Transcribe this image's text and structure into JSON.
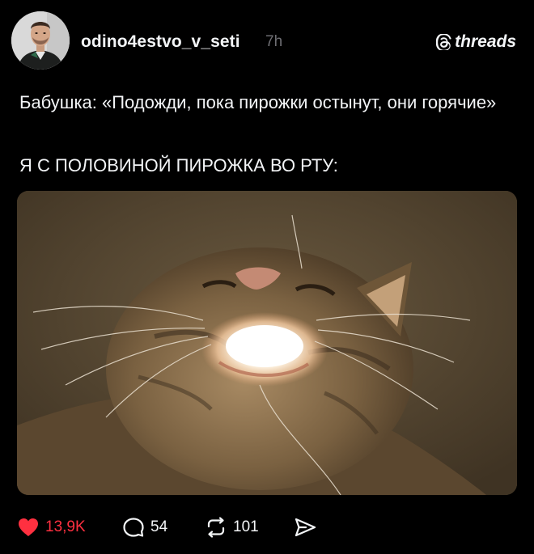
{
  "post": {
    "username": "odino4estvo_v_seti",
    "time": "7h",
    "brand": "threads",
    "text_line1": "Бабушка: «Подожди, пока пирожки остынут, они горячие»",
    "text_line2": "Я С ПОЛОВИНОЙ ПИРОЖКА ВО РТУ:",
    "image_icon": "cat-photo"
  },
  "actions": {
    "likes": "13,9K",
    "comments": "54",
    "reposts": "101"
  },
  "colors": {
    "background": "#000000",
    "text": "#f3f5f7",
    "muted": "#6e6e73",
    "like": "#ff3040"
  }
}
